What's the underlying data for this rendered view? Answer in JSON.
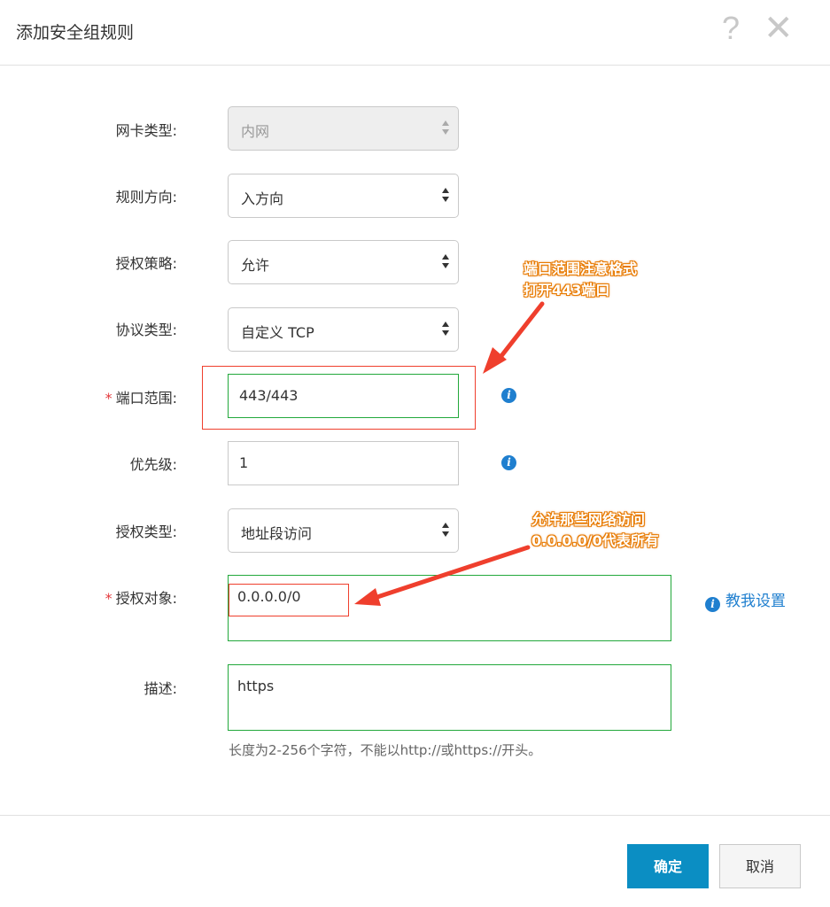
{
  "dialog": {
    "title": "添加安全组规则",
    "help_glyph": "?",
    "close_glyph": "✕"
  },
  "form": {
    "nic_type": {
      "label": "网卡类型:",
      "value": "内网",
      "disabled": true
    },
    "direction": {
      "label": "规则方向:",
      "value": "入方向"
    },
    "policy": {
      "label": "授权策略:",
      "value": "允许"
    },
    "protocol": {
      "label": "协议类型:",
      "value": "自定义 TCP"
    },
    "port_range": {
      "required_mark": "*",
      "label": "端口范围:",
      "value": "443/443"
    },
    "priority": {
      "label": "优先级:",
      "value": "1"
    },
    "auth_type": {
      "label": "授权类型:",
      "value": "地址段访问"
    },
    "auth_object": {
      "required_mark": "*",
      "label": "授权对象:",
      "value": "0.0.0.0/0",
      "help_link": "教我设置"
    },
    "description": {
      "label": "描述:",
      "value": "https",
      "hint": "长度为2-256个字符，不能以http://或https://开头。"
    }
  },
  "info_glyph": "i",
  "footer": {
    "confirm_label": "确定",
    "cancel_label": "取消"
  },
  "annotations": {
    "port_note": [
      "端口范围注意格式",
      "打开443端口"
    ],
    "object_note": [
      "允许那些网络访问",
      "0.0.0.0/0代表所有"
    ]
  },
  "colors": {
    "primary_button": "#0b8ec3",
    "annotation_red": "#ef3f2d",
    "valid_green": "#22a83b",
    "info_blue": "#1f7fcf"
  }
}
